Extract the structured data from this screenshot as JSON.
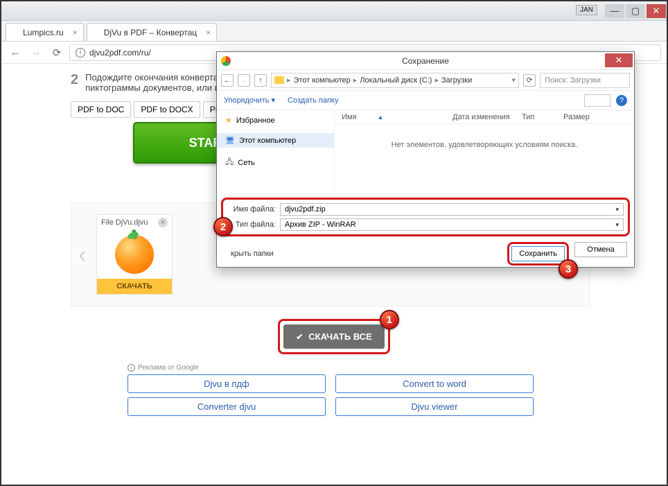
{
  "window": {
    "user": "JAN"
  },
  "tabs": [
    {
      "title": "Lumpics.ru"
    },
    {
      "title": "DjVu в PDF – Конвертац"
    }
  ],
  "url": "djvu2pdf.com/ru/",
  "page": {
    "step_num": "2",
    "step_text_1": "Подождите окончания конверта",
    "step_text_2": "пиктограммы документов, или в",
    "tool_tabs": [
      "PDF to DOC",
      "PDF to DOCX",
      "PDF to T"
    ],
    "start": "START",
    "file": {
      "name": "File DjVu.djvu",
      "download": "СКАЧАТЬ"
    },
    "download_all": "СКАЧАТЬ ВСЕ",
    "ads_label": "Реклама от Google",
    "ad_links": [
      "Djvu в пдф",
      "Convert to word",
      "Converter djvu",
      "Djvu viewer"
    ]
  },
  "dialog": {
    "title": "Сохранение",
    "crumbs": [
      "Этот компьютер",
      "Локальный диск (C:)",
      "Загрузки"
    ],
    "search_placeholder": "Поиск: Загрузки",
    "organize": "Упорядочить",
    "new_folder": "Создать папку",
    "sidebar": {
      "fav": "Избранное",
      "pc": "Этот компьютер",
      "net": "Сеть"
    },
    "columns": {
      "name": "Имя",
      "date": "Дата изменения",
      "type": "Тип",
      "size": "Размер"
    },
    "empty": "Нет элементов, удовлетворяющих условиям поиска.",
    "filename_label": "Имя файла:",
    "filename": "djvu2pdf.zip",
    "filetype_label": "Тип файла:",
    "filetype": "Архив ZIP - WinRAR",
    "hide_folders": "крыть папки",
    "save": "Сохранить",
    "cancel": "Отмена"
  },
  "callouts": {
    "one": "1",
    "two": "2",
    "three": "3"
  }
}
